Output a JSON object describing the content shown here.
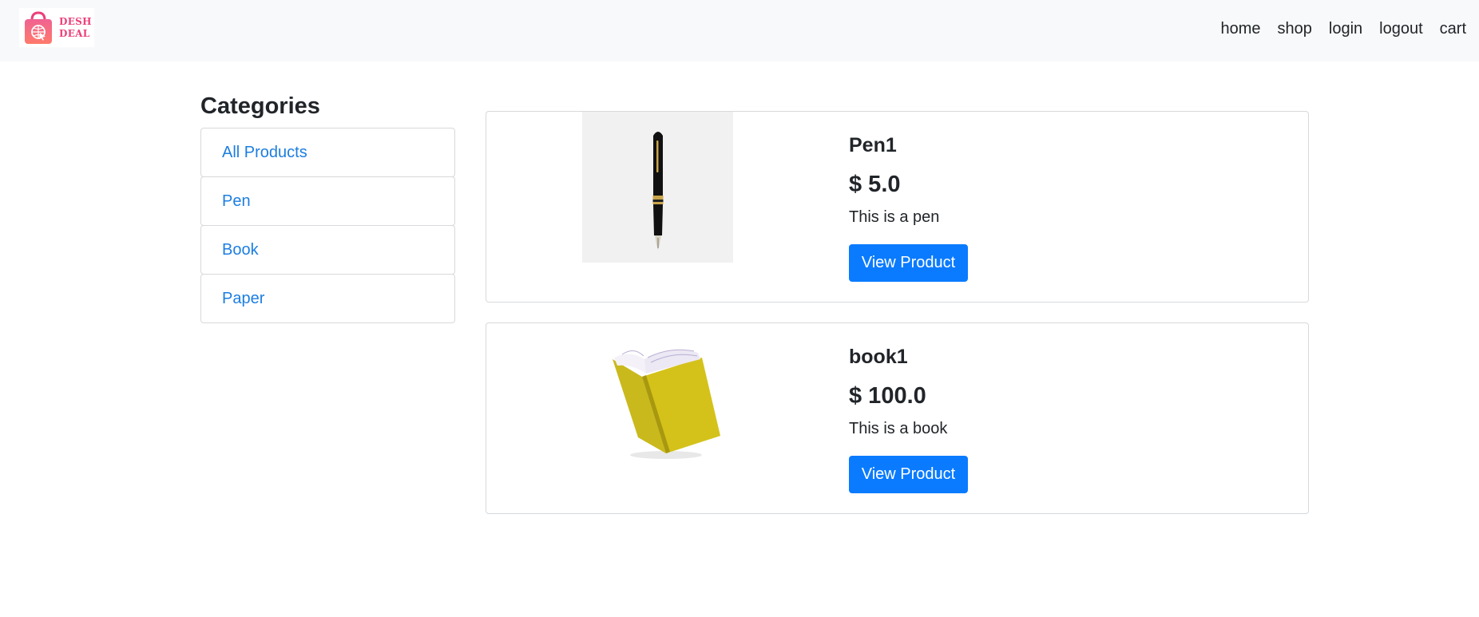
{
  "navbar": {
    "logo": {
      "line1": "DESH",
      "line2": "DEAL"
    },
    "links": [
      "home",
      "shop",
      "login",
      "logout",
      "cart"
    ]
  },
  "categories": {
    "title": "Categories",
    "items": [
      "All Products",
      "Pen",
      "Book",
      "Paper"
    ]
  },
  "products": [
    {
      "name": "Pen1",
      "price": "$ 5.0",
      "description": "This is a pen",
      "button_label": "View Product",
      "image_icon": "fountain-pen"
    },
    {
      "name": "book1",
      "price": "$ 100.0",
      "description": "This is a book",
      "button_label": "View Product",
      "image_icon": "yellow-book"
    }
  ],
  "colors": {
    "navbar_bg": "#f8f9fa",
    "link_blue": "#1c7ee0",
    "button_blue": "#0a7bff",
    "logo_pink": "#ec407a"
  }
}
